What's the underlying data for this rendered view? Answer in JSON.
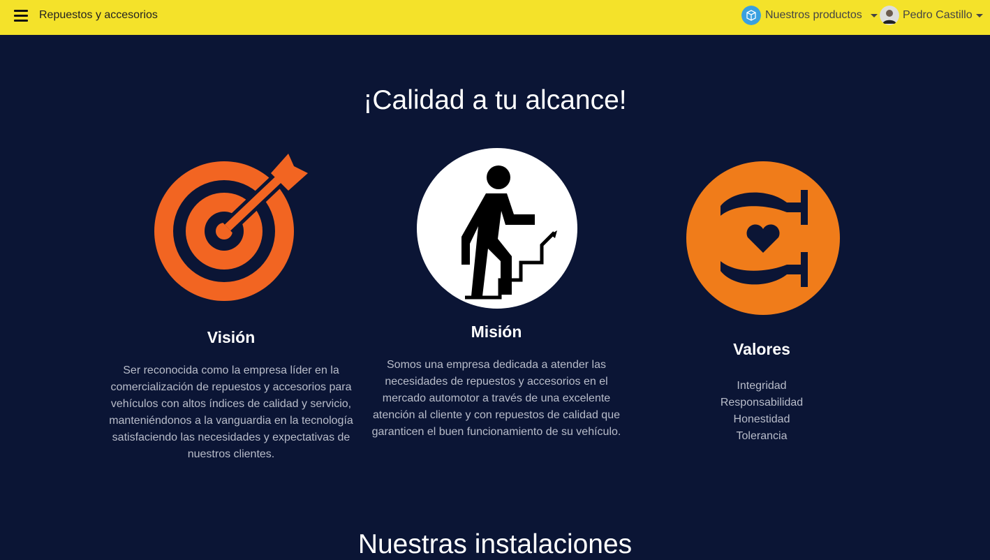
{
  "nav": {
    "brand": "Repuestos y accesorios",
    "products": "Nuestros productos",
    "user": "Pedro Castillo"
  },
  "hero": {
    "title": "¡Calidad a tu alcance!"
  },
  "vision": {
    "title": "Visión",
    "text": "Ser reconocida como la empresa líder en la comercialización de repuestos y accesorios para vehículos con altos índices de calidad y servicio, manteniéndonos a la vanguardia en la tecnología satisfaciendo las necesidades y expectativas de nuestros clientes."
  },
  "mision": {
    "title": "Misión",
    "text": "Somos una empresa dedicada a atender las necesidades de repuestos y accesorios en el mercado automotor a través de una excelente atención al cliente y con repuestos de calidad que garanticen el buen funcionamiento de su vehículo."
  },
  "valores": {
    "title": "Valores",
    "items": [
      "Integridad",
      "Responsabilidad",
      "Honestidad",
      "Tolerancia"
    ]
  },
  "next_section": {
    "title": "Nuestras instalaciones"
  },
  "colors": {
    "nav": "#f4e22a",
    "background": "#0b1535",
    "vision": "#f26522",
    "valores": "#f07c1a"
  }
}
